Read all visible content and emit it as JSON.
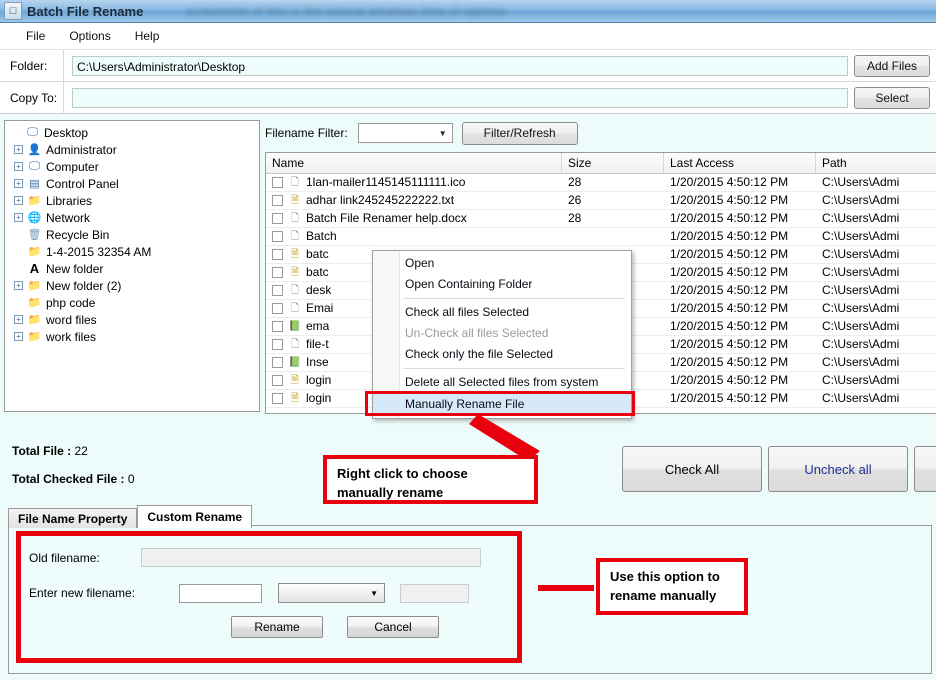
{
  "window": {
    "title": "Batch File Rename",
    "title_blurred_suffix": "screenshot of this is the tutorial windows time of options",
    "icon": "app-icon"
  },
  "menubar": {
    "items": [
      "File",
      "Options",
      "Help"
    ]
  },
  "paths": {
    "folder_label": "Folder:",
    "folder_value": "C:\\Users\\Administrator\\Desktop",
    "add_files_label": "Add Files",
    "copyto_label": "Copy To:",
    "copyto_value": "",
    "select_label": "Select"
  },
  "tree": {
    "items": [
      {
        "label": "Desktop",
        "icon": "monitor-icon",
        "expander": "none",
        "indent": 0
      },
      {
        "label": "Administrator",
        "icon": "user-folder-icon",
        "expander": "plus",
        "indent": 1
      },
      {
        "label": "Computer",
        "icon": "computer-icon",
        "expander": "plus",
        "indent": 1
      },
      {
        "label": "Control Panel",
        "icon": "control-panel-icon",
        "expander": "plus",
        "indent": 1
      },
      {
        "label": "Libraries",
        "icon": "libraries-icon",
        "expander": "plus",
        "indent": 1
      },
      {
        "label": "Network",
        "icon": "network-icon",
        "expander": "plus",
        "indent": 1
      },
      {
        "label": "Recycle Bin",
        "icon": "recycle-bin-icon",
        "expander": "none",
        "indent": 1
      },
      {
        "label": "1-4-2015 32354 AM",
        "icon": "folder-icon",
        "expander": "none",
        "indent": 1
      },
      {
        "label": "New folder",
        "icon": "font-folder-icon",
        "expander": "none",
        "indent": 1
      },
      {
        "label": "New folder (2)",
        "icon": "folder-icon",
        "expander": "plus",
        "indent": 1
      },
      {
        "label": "php code",
        "icon": "folder-icon",
        "expander": "none",
        "indent": 1
      },
      {
        "label": "word files",
        "icon": "folder-icon",
        "expander": "plus",
        "indent": 1
      },
      {
        "label": "work files",
        "icon": "folder-icon",
        "expander": "plus",
        "indent": 1
      }
    ]
  },
  "filter": {
    "label": "Filename Filter:",
    "value": "",
    "button_label": "Filter/Refresh"
  },
  "filelist": {
    "columns": [
      "Name",
      "Size",
      "Last Access",
      "Path"
    ],
    "rows": [
      {
        "name": "1lan-mailer1145145111111.ico",
        "icon": "generic-file-icon",
        "size": "28",
        "access": "1/20/2015 4:50:12 PM",
        "path": "C:\\Users\\Admi"
      },
      {
        "name": "adhar link245245222222.txt",
        "icon": "text-file-icon",
        "size": "26",
        "access": "1/20/2015 4:50:12 PM",
        "path": "C:\\Users\\Admi"
      },
      {
        "name": "Batch File Renamer help.docx",
        "icon": "generic-file-icon",
        "size": "28",
        "access": "1/20/2015 4:50:12 PM",
        "path": "C:\\Users\\Admi"
      },
      {
        "name": "Batch",
        "icon": "generic-file-icon",
        "size": "",
        "access": "1/20/2015 4:50:12 PM",
        "path": "C:\\Users\\Admi"
      },
      {
        "name": "batc",
        "icon": "text-file-icon",
        "size": "",
        "access": "1/20/2015 4:50:12 PM",
        "path": "C:\\Users\\Admi"
      },
      {
        "name": "batc",
        "icon": "text-file-icon",
        "size": "",
        "access": "1/20/2015 4:50:12 PM",
        "path": "C:\\Users\\Admi"
      },
      {
        "name": "desk",
        "icon": "generic-file-icon",
        "size": "",
        "access": "1/20/2015 4:50:12 PM",
        "path": "C:\\Users\\Admi"
      },
      {
        "name": "Emai",
        "icon": "generic-file-icon",
        "size": "",
        "access": "1/20/2015 4:50:12 PM",
        "path": "C:\\Users\\Admi"
      },
      {
        "name": "ema",
        "icon": "excel-file-icon",
        "size": "",
        "access": "1/20/2015 4:50:12 PM",
        "path": "C:\\Users\\Admi"
      },
      {
        "name": "file-t",
        "icon": "generic-file-icon",
        "size": "",
        "access": "1/20/2015 4:50:12 PM",
        "path": "C:\\Users\\Admi"
      },
      {
        "name": "Inse",
        "icon": "excel-file-icon",
        "size": "",
        "access": "1/20/2015 4:50:12 PM",
        "path": "C:\\Users\\Admi"
      },
      {
        "name": "login",
        "icon": "text-file-icon",
        "size": "",
        "access": "1/20/2015 4:50:12 PM",
        "path": "C:\\Users\\Admi"
      },
      {
        "name": "login",
        "icon": "text-file-icon",
        "size": "",
        "access": "1/20/2015 4:50:12 PM",
        "path": "C:\\Users\\Admi"
      }
    ]
  },
  "context_menu": {
    "items": [
      {
        "label": "Open",
        "state": "normal"
      },
      {
        "label": "Open Containing Folder",
        "state": "normal"
      },
      {
        "label": "Check all files Selected",
        "state": "normal"
      },
      {
        "label": "Un-Check  all files Selected",
        "state": "disabled"
      },
      {
        "label": "Check only the file Selected",
        "state": "normal"
      },
      {
        "label": "Delete all Selected files from system",
        "state": "normal"
      },
      {
        "label": "Manually Rename File",
        "state": "selected"
      }
    ]
  },
  "totals": {
    "total_file_label": "Total File :",
    "total_file_value": "22",
    "total_checked_label": "Total Checked File :",
    "total_checked_value": "0"
  },
  "actions": {
    "check_all": "Check All",
    "uncheck_all": "Uncheck all"
  },
  "tabs": [
    {
      "label": "File Name Property",
      "active": false
    },
    {
      "label": "Custom Rename",
      "active": true
    }
  ],
  "custom_rename": {
    "old_filename_label": "Old filename:",
    "old_filename_value": "",
    "new_filename_label": "Enter new filename:",
    "new_filename_value": "",
    "extension_combo_value": "",
    "suffix_value": "",
    "rename_label": "Rename",
    "cancel_label": "Cancel"
  },
  "annotations": [
    {
      "id": "right-click-note",
      "line1": "Right click to choose",
      "line2": "manually rename"
    },
    {
      "id": "manual-rename-note",
      "line1": "Use this option to",
      "line2": "rename manually"
    }
  ],
  "colors": {
    "annotation_red": "#e8000d",
    "panel_cyan": "#eefcfc",
    "uncheck_blue": "#1c2f8f",
    "selection_blue": "#d6e9f9"
  }
}
